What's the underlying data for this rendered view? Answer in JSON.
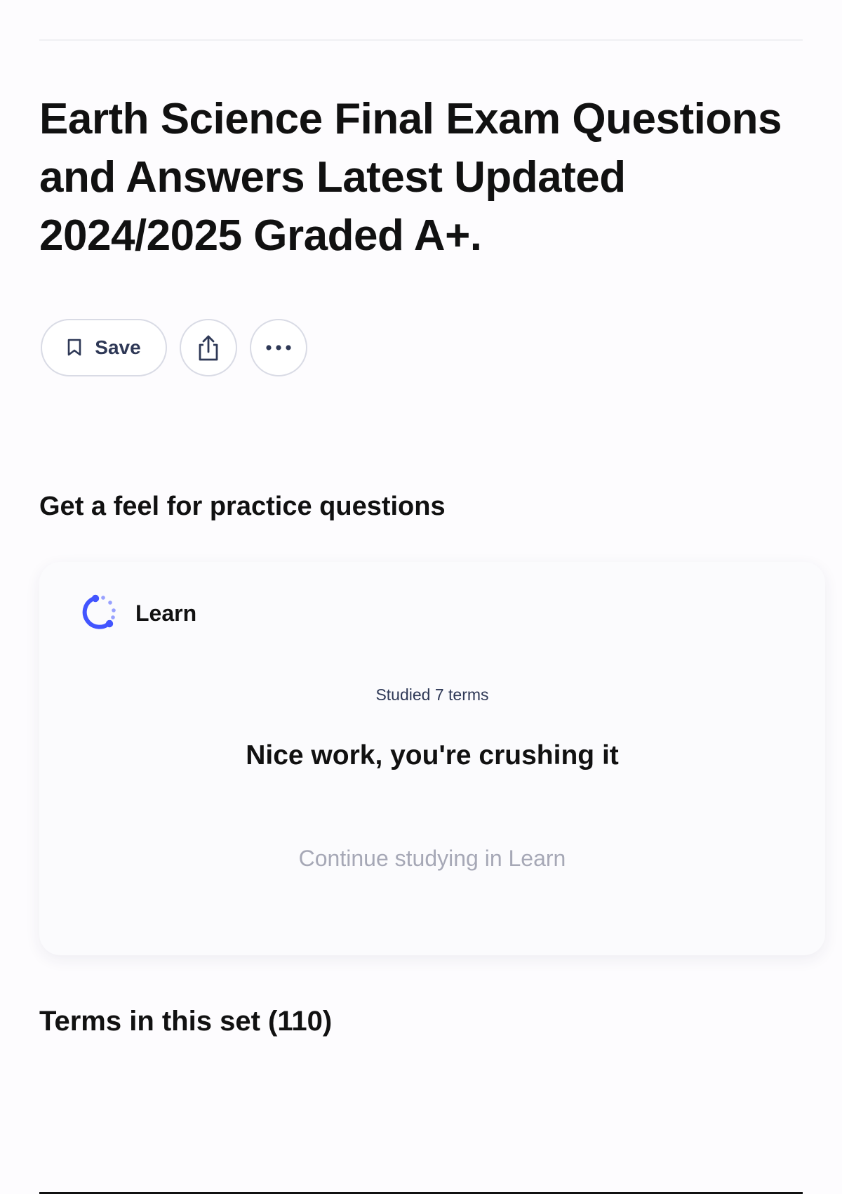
{
  "set": {
    "title": "Earth Science Final Exam Questions and Answers Latest Updated 2024/2025 Graded A+."
  },
  "actions": {
    "save_label": "Save",
    "save_icon": "bookmark-icon",
    "share_icon": "share-icon",
    "more_icon": "more-horizontal-icon"
  },
  "practice": {
    "heading": "Get a feel for practice questions"
  },
  "learn_card": {
    "icon": "learn-icon",
    "label": "Learn",
    "studied": "Studied 7 terms",
    "message": "Nice work, you're crushing it",
    "continue": "Continue studying in Learn",
    "accent_color": "#4255ff"
  },
  "terms": {
    "heading": "Terms in this set (110)"
  }
}
